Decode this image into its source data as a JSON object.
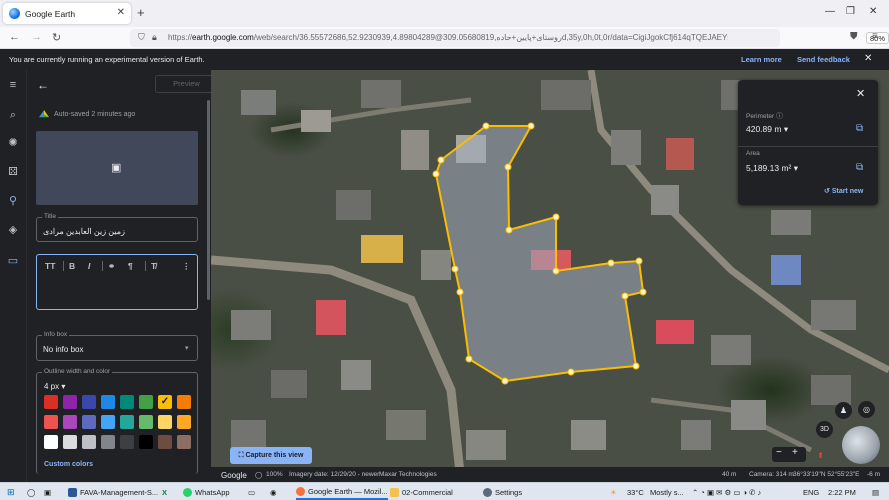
{
  "browser": {
    "tab_title": "Google Earth",
    "url_prefix": "https://",
    "url_domain": "earth.google.com",
    "url_rest": "/web/search/36.55572686,52.9230939,4.89804289@روستای+پایین+حاده,309.05680819d,35y,0h,0t,0r/data=CigiJgokCfj614qTQEJAEYs",
    "zoom": "80%"
  },
  "banner": {
    "message": "You are currently running an experimental version of Earth.",
    "learn_more": "Learn more",
    "send_feedback": "Send feedback"
  },
  "panel": {
    "preview_label": "Preview",
    "autosave": "Auto-saved 2 minutes ago",
    "title_label": "Title",
    "title_value": "زمین زین العابدین مرادی",
    "info_box_label": "Info box",
    "info_box_value": "No info box",
    "outline_label": "Outline width and color",
    "outline_width": "4 px",
    "custom_colors": "Custom colors",
    "swatches": [
      "#d93025",
      "#8e24aa",
      "#3949ab",
      "#1e88e5",
      "#00897b",
      "#43a047",
      "#fbbc04",
      "#f57c00",
      "#ef5350",
      "#ab47bc",
      "#5c6bc0",
      "#42a5f5",
      "#26a69a",
      "#66bb6a",
      "#fdd663",
      "#ffa726",
      "#ffffff",
      "#dadce0",
      "#bdc1c6",
      "#80868b",
      "#3c4043",
      "#000000",
      "#6d4c41",
      "#8d6e63"
    ],
    "selected_swatch": 6
  },
  "measure": {
    "perimeter_label": "Perimeter",
    "perimeter_value": "420.89 m",
    "area_label": "Area",
    "area_value": "5,189.13 m²",
    "start_new": "Start new"
  },
  "map": {
    "capture_label": "Capture this view",
    "threed_label": "3D",
    "footer": {
      "brand": "Google",
      "loaded": "100%",
      "imagery_date": "Imagery date: 12/29/20 - newer",
      "credit": "Maxar Technologies",
      "scale": "40 m",
      "camera": "Camera: 314 m",
      "coords": "36°33'19\"N 52°55'23\"E",
      "elevation": "-6 m"
    },
    "polygon_color": "#fbbc04"
  },
  "taskbar": {
    "items": [
      "FAVA-Management-S...",
      "WhatsApp",
      "Google Earth — Mozil...",
      "02-Commercial",
      "Settings"
    ],
    "weather_temp": "33°C",
    "weather_text": "Mostly s...",
    "lang": "ENG",
    "time": "2:22 PM"
  }
}
